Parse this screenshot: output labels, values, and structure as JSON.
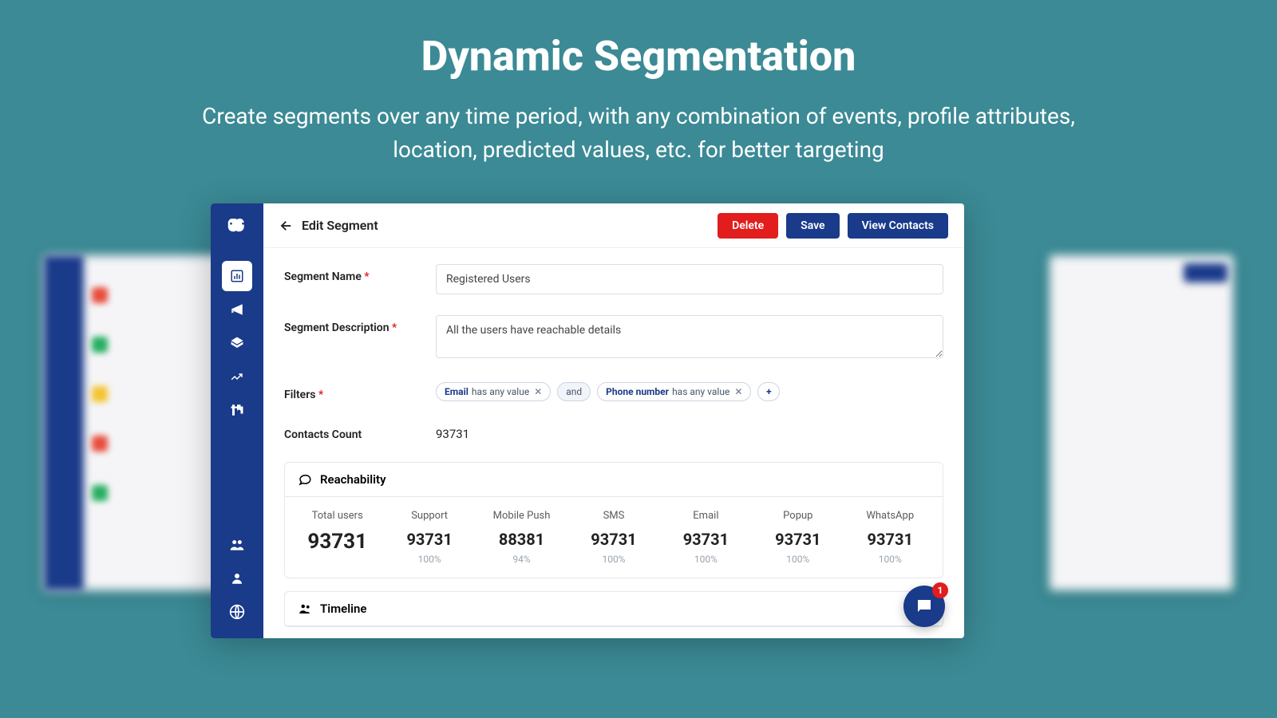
{
  "hero": {
    "title": "Dynamic Segmentation",
    "subtitle": "Create segments over any time period, with any combination of events, profile attributes, location, predicted values, etc. for better targeting"
  },
  "topbar": {
    "title": "Edit Segment",
    "delete": "Delete",
    "save": "Save",
    "view_contacts": "View Contacts"
  },
  "form": {
    "segment_name_label": "Segment Name",
    "segment_name_value": "Registered Users",
    "segment_desc_label": "Segment Description",
    "segment_desc_value": "All the users have reachable details",
    "filters_label": "Filters",
    "contacts_count_label": "Contacts Count",
    "contacts_count_value": "93731"
  },
  "filters": {
    "chip1_key": "Email",
    "chip1_op": "has any value",
    "join1": "and",
    "chip2_key": "Phone number",
    "chip2_op": "has any value",
    "add": "+"
  },
  "reachability": {
    "title": "Reachability",
    "cols": [
      {
        "lbl": "Total users",
        "val": "93731",
        "pct": ""
      },
      {
        "lbl": "Support",
        "val": "93731",
        "pct": "100%"
      },
      {
        "lbl": "Mobile Push",
        "val": "88381",
        "pct": "94%"
      },
      {
        "lbl": "SMS",
        "val": "93731",
        "pct": "100%"
      },
      {
        "lbl": "Email",
        "val": "93731",
        "pct": "100%"
      },
      {
        "lbl": "Popup",
        "val": "93731",
        "pct": "100%"
      },
      {
        "lbl": "WhatsApp",
        "val": "93731",
        "pct": "100%"
      }
    ]
  },
  "timeline": {
    "title": "Timeline"
  },
  "chat": {
    "badge": "1"
  }
}
